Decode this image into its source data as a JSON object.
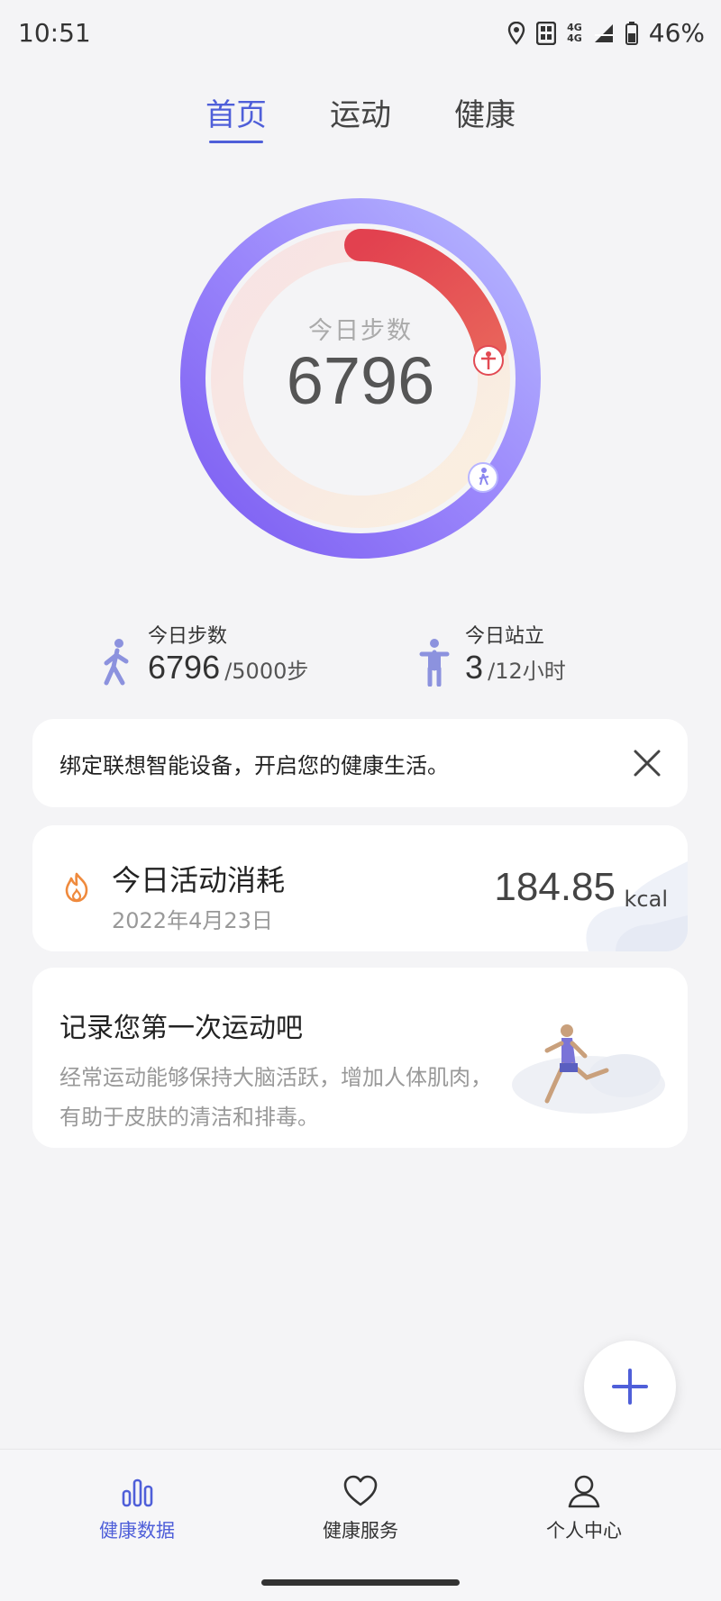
{
  "status_bar": {
    "time": "10:51",
    "network_top": "4G",
    "network_bottom": "4G",
    "battery": "46%"
  },
  "tabs": [
    {
      "label": "首页",
      "active": true
    },
    {
      "label": "运动",
      "active": false
    },
    {
      "label": "健康",
      "active": false
    }
  ],
  "ring": {
    "label": "今日步数",
    "value": "6796",
    "steps_progress": 1.0,
    "stand_progress": 0.25
  },
  "stats": {
    "steps": {
      "label": "今日步数",
      "value": "6796",
      "goal": "/5000步"
    },
    "stand": {
      "label": "今日站立",
      "value": "3",
      "goal": "/12小时"
    }
  },
  "bind_card": {
    "text": "绑定联想智能设备，开启您的健康生活。"
  },
  "activity_card": {
    "title": "今日活动消耗",
    "date": "2022年4月23日",
    "value": "184.85",
    "unit": "kcal"
  },
  "record_card": {
    "title": "记录您第一次运动吧",
    "desc_line1": "经常运动能够保持大脑活跃，增加人体肌肉，",
    "desc_line2": "有助于皮肤的清洁和排毒。"
  },
  "bottom_nav": [
    {
      "label": "健康数据",
      "icon": "bar-chart-icon",
      "active": true
    },
    {
      "label": "健康服务",
      "icon": "heart-icon",
      "active": false
    },
    {
      "label": "个人中心",
      "icon": "person-icon",
      "active": false
    }
  ],
  "colors": {
    "accent": "#4f5fd9",
    "ring_outer_start": "#a8b0ff",
    "ring_outer_end": "#7a5cf0",
    "ring_inner_start": "#e44a5a",
    "ring_inner_end": "#e5605c",
    "flame": "#ef8a3d"
  }
}
